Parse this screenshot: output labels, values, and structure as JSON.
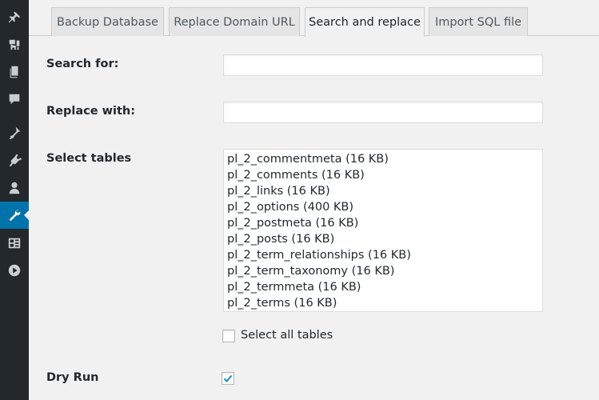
{
  "sidebar": {
    "icons": [
      "pin-icon",
      "media-icon",
      "pages-icon",
      "comments-icon",
      "appearance-icon",
      "plugins-icon",
      "users-icon",
      "tools-icon",
      "settings-icon",
      "play-icon"
    ],
    "active": "tools-icon"
  },
  "tabs": [
    {
      "label": "Backup Database"
    },
    {
      "label": "Replace Domain URL"
    },
    {
      "label": "Search and replace"
    },
    {
      "label": "Import SQL file"
    }
  ],
  "form": {
    "search_label": "Search for:",
    "search_value": "",
    "replace_label": "Replace with:",
    "replace_value": "",
    "tables_label": "Select tables",
    "tables": [
      "pl_2_commentmeta (16 KB)",
      "pl_2_comments (16 KB)",
      "pl_2_links (16 KB)",
      "pl_2_options (400 KB)",
      "pl_2_postmeta (16 KB)",
      "pl_2_posts (16 KB)",
      "pl_2_term_relationships (16 KB)",
      "pl_2_term_taxonomy (16 KB)",
      "pl_2_termmeta (16 KB)",
      "pl_2_terms (16 KB)"
    ],
    "select_all_label": "Select all tables",
    "select_all_checked": false,
    "dry_run_label": "Dry Run",
    "dry_run_checked": true
  },
  "colors": {
    "accent": "#0073aa",
    "sidebar_bg": "#23282d",
    "page_bg": "#f1f1f1"
  }
}
